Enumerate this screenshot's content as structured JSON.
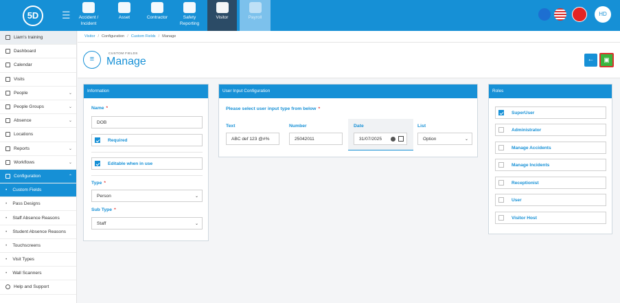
{
  "app": {
    "logo": "5D"
  },
  "colors": {
    "primary": "#1690d6",
    "save": "#3ab53e",
    "required": "#e53935",
    "dark_tab": "#2b4b66"
  },
  "nav_tabs": [
    {
      "label": "Accident / Incident",
      "icon": "accident-icon"
    },
    {
      "label": "Asset",
      "icon": "asset-icon"
    },
    {
      "label": "Contractor",
      "icon": "contractor-icon"
    },
    {
      "label": "Safety Reporting",
      "icon": "safety-icon"
    },
    {
      "label": "Visitor",
      "icon": "visitor-icon",
      "active": true
    },
    {
      "label": "Payroll",
      "icon": "payroll-icon"
    }
  ],
  "top_right": {
    "avatar": "HD",
    "icons": [
      "bell-icon",
      "flag-icon",
      "alert-icon"
    ]
  },
  "sidebar": {
    "training": "Liam's training",
    "items": [
      {
        "label": "Dashboard",
        "icon": "dashboard-icon"
      },
      {
        "label": "Calendar",
        "icon": "calendar-icon"
      },
      {
        "label": "Visits",
        "icon": "visits-icon"
      },
      {
        "label": "People",
        "icon": "people-icon",
        "chevron": true
      },
      {
        "label": "People Groups",
        "icon": "people-groups-icon",
        "chevron": true
      },
      {
        "label": "Absence",
        "icon": "absence-icon",
        "chevron": true
      },
      {
        "label": "Locations",
        "icon": "locations-icon"
      },
      {
        "label": "Reports",
        "icon": "reports-icon",
        "chevron": true
      },
      {
        "label": "Workflows",
        "icon": "workflows-icon",
        "chevron": true
      },
      {
        "label": "Configuration",
        "icon": "configuration-icon",
        "chevron": true,
        "active": true
      }
    ],
    "sub_items": [
      {
        "label": "Custom Fields",
        "active": true
      },
      {
        "label": "Pass Designs"
      },
      {
        "label": "Staff Absence Reasons"
      },
      {
        "label": "Student Absence Reasons"
      },
      {
        "label": "Touchscreens"
      },
      {
        "label": "Visit Types"
      },
      {
        "label": "Wall Scanners"
      }
    ],
    "help": "Help and Support"
  },
  "breadcrumb": {
    "items": [
      "Visitor",
      "Configuration",
      "Custom Fields",
      "Manage"
    ]
  },
  "header": {
    "small": "CUSTOM FIELDS",
    "title": "Manage"
  },
  "information": {
    "title": "Information",
    "name_label": "Name",
    "name_value": "DOB",
    "required_label": "Required",
    "editable_label": "Editable when in use",
    "type_label": "Type",
    "type_value": "Person",
    "subtype_label": "Sub Type",
    "subtype_value": "Staff",
    "required_mark": "*"
  },
  "user_input": {
    "title": "User Input Configuration",
    "prompt": "Please select user input type from below",
    "text_label": "Text",
    "text_value": "ABC def 123 @#%",
    "number_label": "Number",
    "number_value": "25042011",
    "date_label": "Date",
    "date_value": "31/07/2025",
    "list_label": "List",
    "list_value": "Option"
  },
  "roles": {
    "title": "Roles",
    "items": [
      {
        "label": "SuperUser",
        "checked": true
      },
      {
        "label": "Administrator",
        "checked": false
      },
      {
        "label": "Manage Accidents",
        "checked": false
      },
      {
        "label": "Manage Incidents",
        "checked": false
      },
      {
        "label": "Receptionist",
        "checked": false
      },
      {
        "label": "User",
        "checked": false
      },
      {
        "label": "Visitor Host",
        "checked": false
      }
    ]
  }
}
